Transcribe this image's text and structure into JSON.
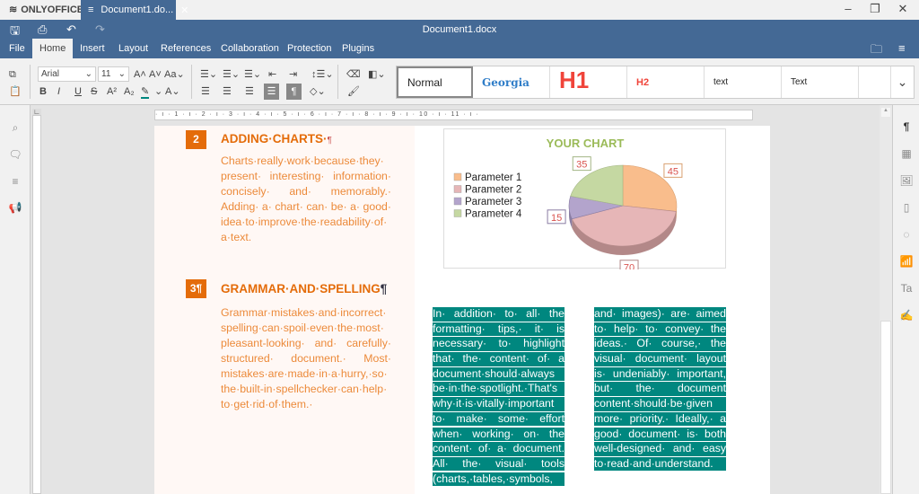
{
  "app": {
    "brand": "ONLYOFFICE",
    "tab_label": "Document1.do...",
    "title": "Document1.docx"
  },
  "menu": [
    "File",
    "Home",
    "Insert",
    "Layout",
    "References",
    "Collaboration",
    "Protection",
    "Plugins"
  ],
  "toolbar": {
    "font": "Arial",
    "size": "11"
  },
  "styles": [
    "Normal",
    "Georgia",
    "H1",
    "H2",
    "text",
    "Text"
  ],
  "ruler": "· ı · 1 · ı · 2 · ı · 3 · ı · 4 · ı · 5 · ı · 6 · ı · 7 · ı · 8 · ı · 9 · ı · 10 · ı · 11 · ı ·",
  "sections": [
    {
      "num": "2",
      "heading": "ADDING·CHARTS·",
      "lines": [
        "Charts·really·work·because·they·",
        "present· interesting· information·",
        "concisely· and· memorably.·",
        "Adding· a· chart· can· be· a· good·",
        "idea·to·improve·the·readability·of·"
      ],
      "last": "a·text."
    },
    {
      "num": "3",
      "heading": "GRAMMAR·AND·SPELLING",
      "lines": [
        "Grammar·mistakes·and·incorrect·",
        "spelling·can·spoil·even·the·most·",
        "pleasant-looking· and· carefully·",
        "structured· document.· Most·",
        "mistakes·are·made·in·a·hurry,·so·",
        "the·built-in·spellchecker·can·help·"
      ],
      "last": "to·get·rid·of·them.·"
    }
  ],
  "pilcrow": "¶",
  "col1": [
    "In· addition· to· all· the",
    "formatting· tips,· it· is",
    "necessary· to· highlight",
    "that· the· content· of· a",
    "document·should·always",
    "be·in·the·spotlight.·That's",
    "why·it·is·vitally·important",
    "to· make· some· effort",
    "when· working· on· the",
    "content· of· a· document.",
    "All· the· visual· tools",
    "(charts,·tables,·symbols,"
  ],
  "col2": [
    "and· images)· are· aimed",
    "to· help· to· convey· the",
    "ideas.· Of· course,· the",
    "visual· document· layout",
    "is· undeniably· important,",
    "but· the· document",
    "content·should·be·given",
    "more· priority.· Ideally,· a",
    "good· document· is· both",
    "well-designed· and· easy",
    "to·read·and·understand."
  ],
  "chart_data": {
    "type": "pie",
    "title": "YOUR CHART",
    "categories": [
      "Parameter 1",
      "Parameter 2",
      "Parameter 3",
      "Parameter 4"
    ],
    "values": [
      45,
      70,
      15,
      35
    ],
    "colors": [
      "#f9bd8c",
      "#e6b6b7",
      "#b3a4cc",
      "#c5d8a2"
    ],
    "legend": "left"
  },
  "colors": {
    "header": "#446995",
    "accent": "#e46c0a",
    "highlight": "#00877f"
  }
}
